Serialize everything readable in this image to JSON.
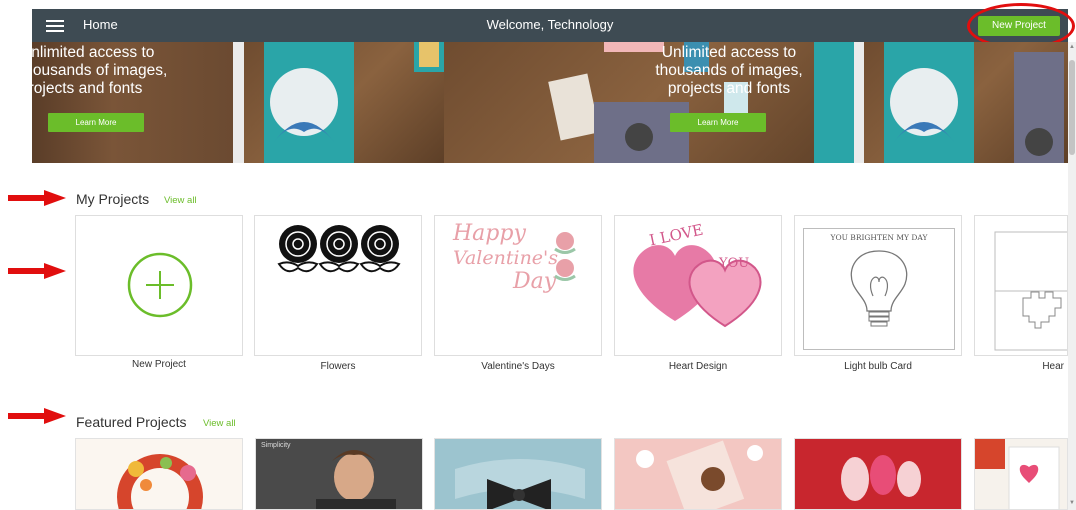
{
  "header": {
    "home_label": "Home",
    "welcome_text": "Welcome, Technology",
    "new_project_label": "New Project",
    "bar_color": "#3e4b53",
    "accent": "#6bbd2a"
  },
  "banner": {
    "left_line1": "Unlimited access to",
    "left_line2": "thousands of images,",
    "left_line3": "projects and fonts",
    "center_line1": "Unlimited access to",
    "center_line2": "thousands of images,",
    "center_line3": "projects and fonts",
    "learn_more": "Learn More"
  },
  "my_projects": {
    "title": "My Projects",
    "view_all": "View all",
    "items": [
      {
        "label": "New Project"
      },
      {
        "label": "Flowers"
      },
      {
        "label": "Valentine's Days"
      },
      {
        "label": "Heart Design"
      },
      {
        "label": "Light bulb Card"
      },
      {
        "label": "Hear"
      }
    ],
    "valentine_art_line1": "Happy",
    "valentine_art_line2": "Valentine's",
    "valentine_art_line3": "Day",
    "heart_art_top": "I LOVE",
    "heart_art_bottom": "YOU",
    "bulb_art_text": "YOU BRIGHTEN MY DAY"
  },
  "featured_projects": {
    "title": "Featured Projects",
    "view_all": "View all",
    "brand_tag": "Simplicity"
  }
}
